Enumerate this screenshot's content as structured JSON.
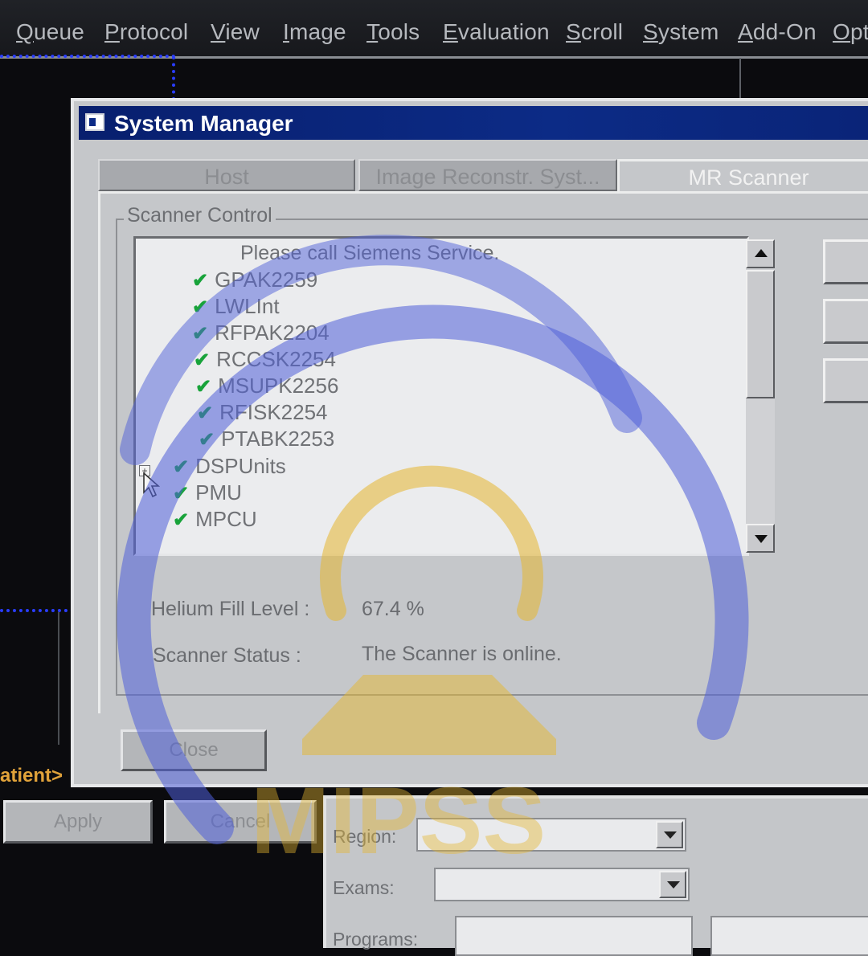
{
  "menubar": {
    "items": [
      "Queue",
      "Protocol",
      "View",
      "Image",
      "Tools",
      "Evaluation",
      "Scroll",
      "System",
      "Add-On",
      "Opt"
    ]
  },
  "background": {
    "patient_label": "atient>",
    "apply_label": "Apply",
    "cancel_label": "Cancel",
    "region_label": "Region:",
    "exams_label": "Exams:",
    "programs_label": "Programs:"
  },
  "dialog": {
    "title": "System Manager",
    "tabs": [
      {
        "label": "Host",
        "active": false
      },
      {
        "label": "Image Reconstr. Syst...",
        "active": false
      },
      {
        "label": "MR Scanner",
        "active": true
      }
    ],
    "group_title": "Scanner Control",
    "tree": {
      "message": "Please call Siemens Service.",
      "items": [
        {
          "label": "GPAK2259",
          "ok": true
        },
        {
          "label": "LWLInt",
          "ok": true
        },
        {
          "label": "RFPAK2204",
          "ok": true
        },
        {
          "label": "RCCSK2254",
          "ok": true
        },
        {
          "label": "MSUPK2256",
          "ok": true
        },
        {
          "label": "RFISK2254",
          "ok": true
        },
        {
          "label": "PTABK2253",
          "ok": true
        },
        {
          "label": "DSPUnits",
          "ok": true,
          "expandable": true
        },
        {
          "label": "PMU",
          "ok": true
        },
        {
          "label": "MPCU",
          "ok": true
        }
      ]
    },
    "helium_label": "Helium Fill Level :",
    "helium_value": "67.4 %",
    "status_label": "Scanner Status :",
    "status_value": "The Scanner is online.",
    "close_label": "Close"
  },
  "watermark": {
    "text": "MIPSS",
    "blue": "#4f5fd8",
    "gold": "#e6b730"
  },
  "colors": {
    "check_green": "#18a33a",
    "title_blue": "#0c2b86"
  }
}
